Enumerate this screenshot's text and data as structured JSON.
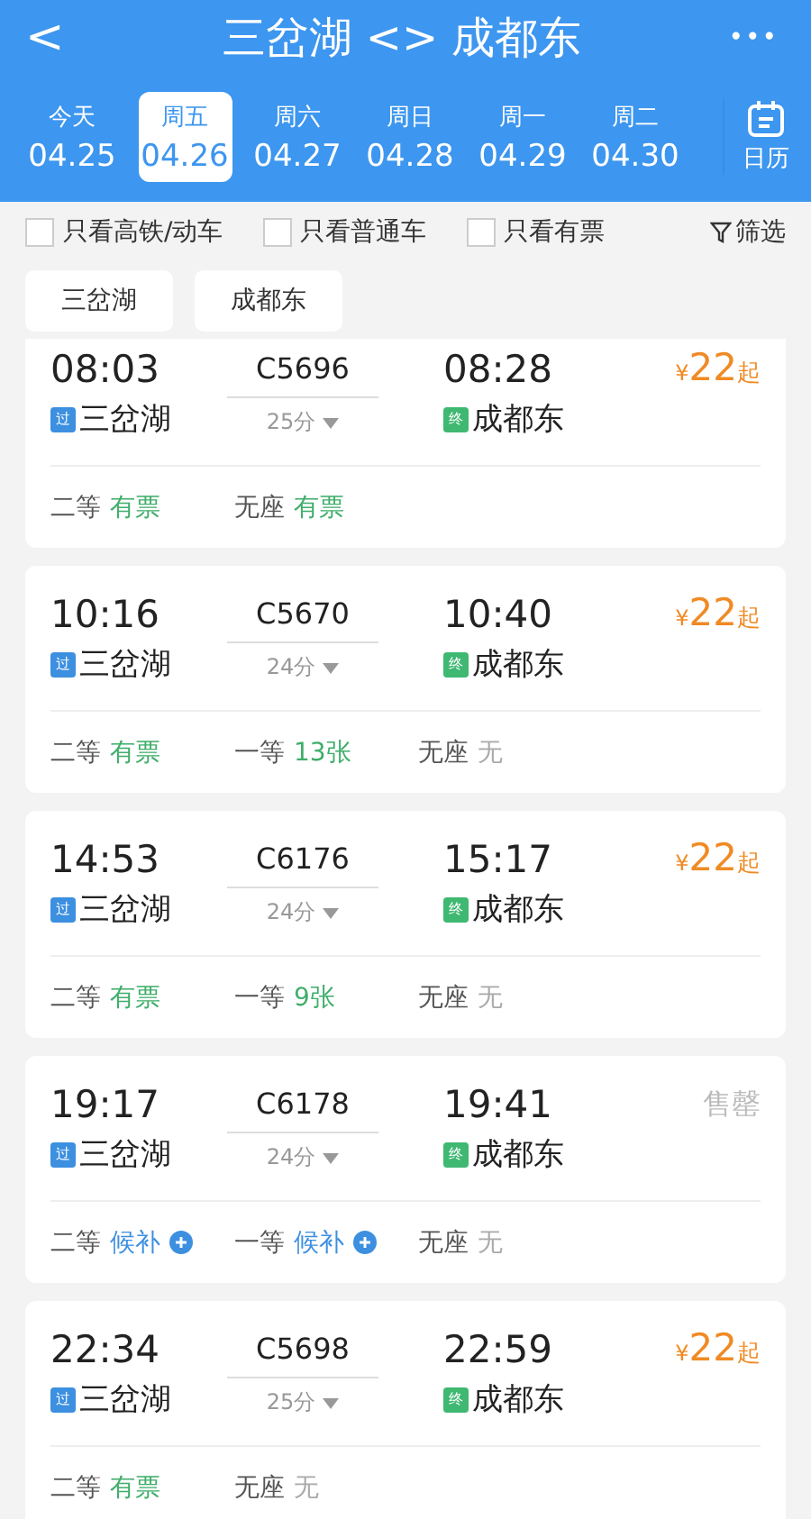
{
  "header": {
    "back": "<",
    "title": "三岔湖 <> 成都东",
    "more": "•••"
  },
  "dates": [
    {
      "weekday": "今天",
      "date": "04.25",
      "selected": false
    },
    {
      "weekday": "周五",
      "date": "04.26",
      "selected": true
    },
    {
      "weekday": "周六",
      "date": "04.27",
      "selected": false
    },
    {
      "weekday": "周日",
      "date": "04.28",
      "selected": false
    },
    {
      "weekday": "周一",
      "date": "04.29",
      "selected": false
    },
    {
      "weekday": "周二",
      "date": "04.30",
      "selected": false
    }
  ],
  "calendar": {
    "label": "日历"
  },
  "filters": [
    {
      "label": "只看高铁/动车",
      "checked": false
    },
    {
      "label": "只看普通车",
      "checked": false
    },
    {
      "label": "只看有票",
      "checked": false
    }
  ],
  "filter_button": "筛选",
  "stations": [
    "三岔湖",
    "成都东"
  ],
  "trains": [
    {
      "depart": "08:03",
      "train": "C5696",
      "arrive": "08:28",
      "duration": "25分",
      "from_tag": "过",
      "from": "三岔湖",
      "to_tag": "终",
      "to": "成都东",
      "fare": {
        "kind": "price",
        "currency": "¥",
        "amount": "22",
        "suffix": "起"
      },
      "seats": [
        {
          "class": "二等",
          "status": "有票",
          "kind": "available"
        },
        {
          "class": "无座",
          "status": "有票",
          "kind": "available"
        }
      ]
    },
    {
      "depart": "10:16",
      "train": "C5670",
      "arrive": "10:40",
      "duration": "24分",
      "from_tag": "过",
      "from": "三岔湖",
      "to_tag": "终",
      "to": "成都东",
      "fare": {
        "kind": "price",
        "currency": "¥",
        "amount": "22",
        "suffix": "起"
      },
      "seats": [
        {
          "class": "二等",
          "status": "有票",
          "kind": "available"
        },
        {
          "class": "一等",
          "status": "13张",
          "kind": "available"
        },
        {
          "class": "无座",
          "status": "无",
          "kind": "none"
        }
      ]
    },
    {
      "depart": "14:53",
      "train": "C6176",
      "arrive": "15:17",
      "duration": "24分",
      "from_tag": "过",
      "from": "三岔湖",
      "to_tag": "终",
      "to": "成都东",
      "fare": {
        "kind": "price",
        "currency": "¥",
        "amount": "22",
        "suffix": "起"
      },
      "seats": [
        {
          "class": "二等",
          "status": "有票",
          "kind": "available"
        },
        {
          "class": "一等",
          "status": "9张",
          "kind": "available"
        },
        {
          "class": "无座",
          "status": "无",
          "kind": "none"
        }
      ]
    },
    {
      "depart": "19:17",
      "train": "C6178",
      "arrive": "19:41",
      "duration": "24分",
      "from_tag": "过",
      "from": "三岔湖",
      "to_tag": "终",
      "to": "成都东",
      "fare": {
        "kind": "sold_out",
        "label": "售罄"
      },
      "seats": [
        {
          "class": "二等",
          "status": "候补",
          "kind": "waitlist"
        },
        {
          "class": "一等",
          "status": "候补",
          "kind": "waitlist"
        },
        {
          "class": "无座",
          "status": "无",
          "kind": "none"
        }
      ]
    },
    {
      "depart": "22:34",
      "train": "C5698",
      "arrive": "22:59",
      "duration": "25分",
      "from_tag": "过",
      "from": "三岔湖",
      "to_tag": "终",
      "to": "成都东",
      "fare": {
        "kind": "price",
        "currency": "¥",
        "amount": "22",
        "suffix": "起"
      },
      "seats": [
        {
          "class": "二等",
          "status": "有票",
          "kind": "available"
        },
        {
          "class": "无座",
          "status": "无",
          "kind": "none"
        }
      ]
    }
  ]
}
